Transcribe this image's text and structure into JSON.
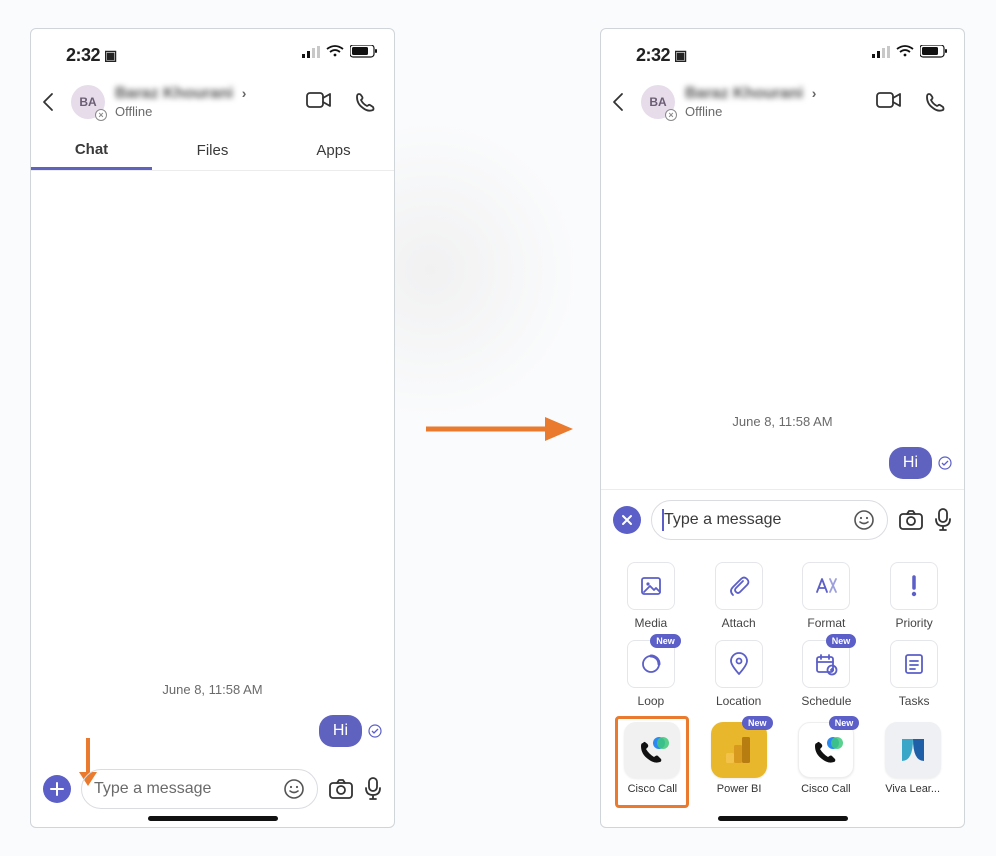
{
  "status": {
    "time": "2:32"
  },
  "contact": {
    "initials": "BA",
    "name_blurred": "Baraz Khourani",
    "status": "Offline"
  },
  "tabs": [
    "Chat",
    "Files",
    "Apps"
  ],
  "active_tab_index": 0,
  "conversation": {
    "date_label": "June 8, 11:58 AM",
    "messages": [
      {
        "from": "me",
        "text": "Hi",
        "read": true
      }
    ]
  },
  "composer": {
    "placeholder": "Type a message"
  },
  "actions": [
    {
      "key": "media",
      "label": "Media",
      "icon": "image",
      "new": false
    },
    {
      "key": "attach",
      "label": "Attach",
      "icon": "paperclip",
      "new": false
    },
    {
      "key": "format",
      "label": "Format",
      "icon": "format",
      "new": false
    },
    {
      "key": "priority",
      "label": "Priority",
      "icon": "priority",
      "new": false
    },
    {
      "key": "loop",
      "label": "Loop",
      "icon": "loop",
      "new": true
    },
    {
      "key": "location",
      "label": "Location",
      "icon": "location",
      "new": false
    },
    {
      "key": "schedule",
      "label": "Schedule",
      "icon": "schedule",
      "new": true
    },
    {
      "key": "tasks",
      "label": "Tasks",
      "icon": "tasks",
      "new": false
    }
  ],
  "badges": {
    "new_label": "New"
  },
  "apps": [
    {
      "label": "Cisco Call",
      "icon": "cisco",
      "bg": "#f1f1f1",
      "highlighted": true,
      "new": false
    },
    {
      "label": "Power BI",
      "icon": "powerbi",
      "bg": "#e9b72b",
      "highlighted": false,
      "new": true
    },
    {
      "label": "Cisco Call",
      "icon": "cisco",
      "bg": "#ffffff",
      "highlighted": false,
      "new": true
    },
    {
      "label": "Viva Lear...",
      "icon": "viva",
      "bg": "#eef0f3",
      "highlighted": false,
      "new": false
    }
  ],
  "colors": {
    "accent": "#5b5fc7",
    "annotation": "#ea7a2d"
  }
}
